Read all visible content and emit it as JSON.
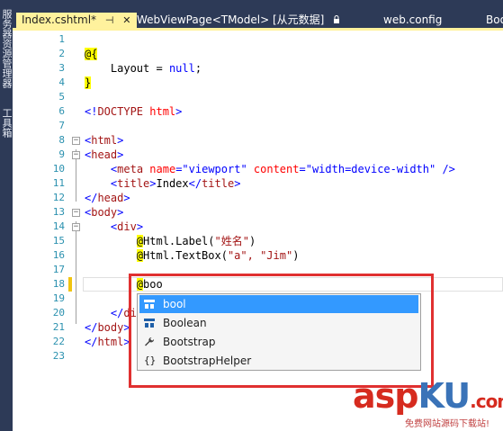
{
  "sidebar": {
    "labels": [
      "服务器资源管理器",
      "工具箱"
    ]
  },
  "tabs": [
    {
      "label": "Index.cshtml*",
      "pin": "⊣",
      "close": "✕",
      "active": true
    },
    {
      "label": "WebViewPage<TModel> [从元数据]",
      "icon": "🔒",
      "active": false
    },
    {
      "label": "web.config",
      "active": false
    },
    {
      "label": "Boo",
      "active": false
    }
  ],
  "editor": {
    "line_numbers": [
      "1",
      "2",
      "3",
      "4",
      "5",
      "6",
      "7",
      "8",
      "9",
      "10",
      "11",
      "12",
      "13",
      "14",
      "15",
      "16",
      "17",
      "18",
      "19",
      "20",
      "21",
      "22",
      "23"
    ],
    "lines": {
      "l2a": "@{",
      "l3a": "Layout",
      "l3b": " = ",
      "l3c": "null",
      "l3d": ";",
      "l4a": "}",
      "l6a": "<!",
      "l6b": "DOCTYPE",
      "l6c": " html",
      "l6d": ">",
      "l8": "html",
      "l9": "head",
      "l10tag": "meta",
      "l10attr1": "name",
      "l10val1": "\"viewport\"",
      "l10attr2": "content",
      "l10val2": "\"width=device-width\"",
      "l11tag": "title",
      "l11text": "Index",
      "l12": "head",
      "l13": "body",
      "l14": "div",
      "l15a": "@",
      "l15b": "Html.Label(",
      "l15c": "\"姓名\"",
      "l15d": ")",
      "l16a": "@",
      "l16b": "Html.TextBox(",
      "l16c": "\"a\", \"Jim\"",
      "l16d": ")",
      "l18a": "@",
      "l18b": "boo",
      "l20": "div",
      "l21": "body",
      "l22": "html"
    }
  },
  "completion": {
    "items": [
      {
        "label": "bool",
        "icon": "type-icon",
        "selected": true
      },
      {
        "label": "Boolean",
        "icon": "type-icon",
        "selected": false
      },
      {
        "label": "Bootstrap",
        "icon": "wrench-icon",
        "selected": false
      },
      {
        "label": "BootstrapHelper",
        "icon": "namespace-icon",
        "selected": false
      }
    ]
  },
  "watermark": {
    "logo_a": "asp",
    "logo_b": "KU",
    "logo_c": ".com",
    "subtitle": "免费网站源码下载站!"
  },
  "colors": {
    "chrome": "#2d3a57",
    "active_tab": "#fff29d",
    "selection": "#3399ff",
    "highlight_box": "#e03030",
    "razor_bg": "#ffff00"
  }
}
